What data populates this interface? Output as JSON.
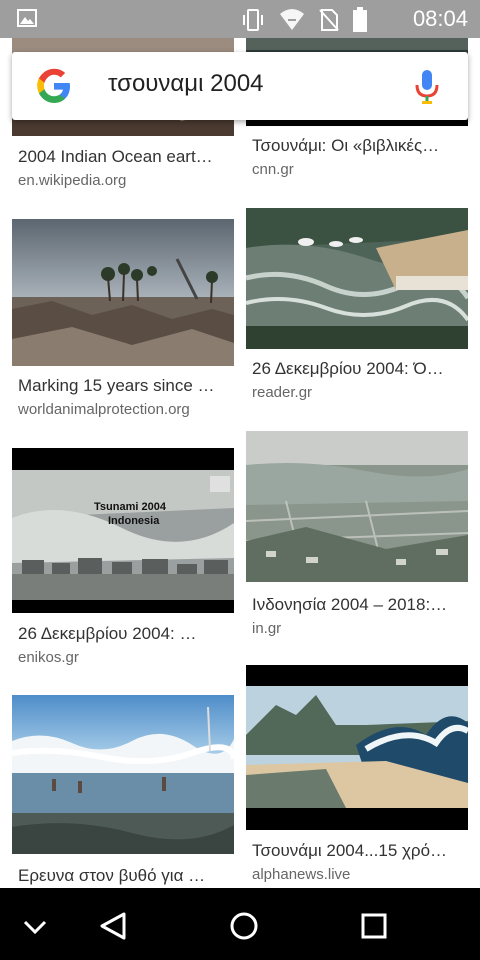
{
  "status_bar": {
    "time": "08:04"
  },
  "search": {
    "query": "τσουναμι 2004"
  },
  "results": [
    {
      "title": "2004 Indian Ocean eart…",
      "source": "en.wikipedia.org"
    },
    {
      "title": "Τσουνάμι: Οι «βιβλικές…",
      "source": "cnn.gr"
    },
    {
      "title": "Marking 15 years since …",
      "source": "worldanimalprotection.org"
    },
    {
      "title": "26 Δεκεμβρίου 2004: Ό…",
      "source": "reader.gr"
    },
    {
      "title": "26 Δεκεμβρίου 2004: …",
      "source": "enikos.gr",
      "image_caption_1": "Tsunami 2004",
      "image_caption_2": "Indonesia"
    },
    {
      "title": "Ινδονησία 2004 – 2018:…",
      "source": "in.gr"
    },
    {
      "title": "Ερευνα στον βυθό για …",
      "source": ""
    },
    {
      "title": "Τσουνάμι 2004...15 χρό…",
      "source": "alphanews.live"
    }
  ],
  "colors": {
    "status_bar": "#9e9e9e",
    "nav_bar": "#000000",
    "title_text": "#333333",
    "source_text": "#666666"
  },
  "icons": [
    "image-icon",
    "vibrate-icon",
    "wifi-icon",
    "no-sim-icon",
    "battery-icon",
    "google-logo-icon",
    "mic-icon",
    "back-chevron-icon",
    "back-triangle-icon",
    "home-circle-icon",
    "recents-square-icon"
  ]
}
